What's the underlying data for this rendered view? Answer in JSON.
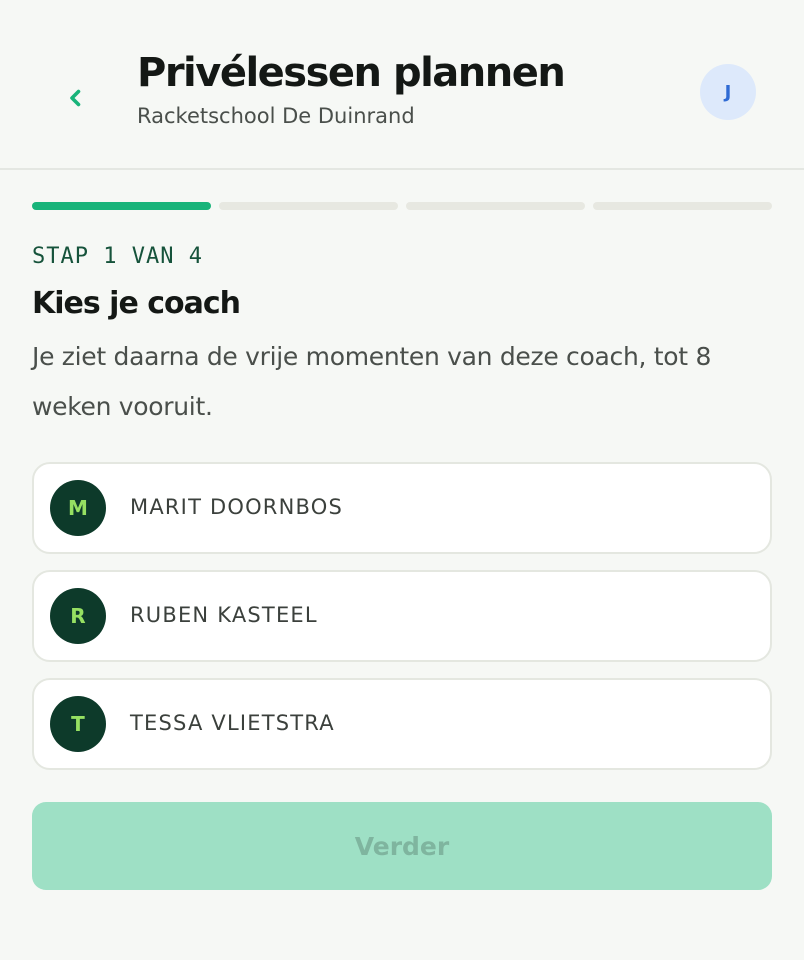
{
  "header": {
    "title": "Privélessen plannen",
    "subtitle": "Racketschool De Duinrand",
    "back_icon": "chevron-left-icon",
    "avatar_initial": "J"
  },
  "progress": {
    "current_step": 1,
    "total_steps": 4
  },
  "step": {
    "label": "STAP 1 VAN 4",
    "title": "Kies je coach",
    "description": "Je ziet daarna de vrije momenten van deze coach, tot 8 weken vooruit."
  },
  "coaches": [
    {
      "initial": "M",
      "name": "MARIT DOORNBOS"
    },
    {
      "initial": "R",
      "name": "RUBEN KASTEEL"
    },
    {
      "initial": "T",
      "name": "TESSA VLIETSTRA"
    }
  ],
  "actions": {
    "next_label": "Verder",
    "next_enabled": false
  },
  "colors": {
    "accent": "#18b47a",
    "coach_badge_bg": "#0d3a2a",
    "coach_badge_text": "#96e062",
    "button_disabled_bg": "#9ee0c5"
  }
}
